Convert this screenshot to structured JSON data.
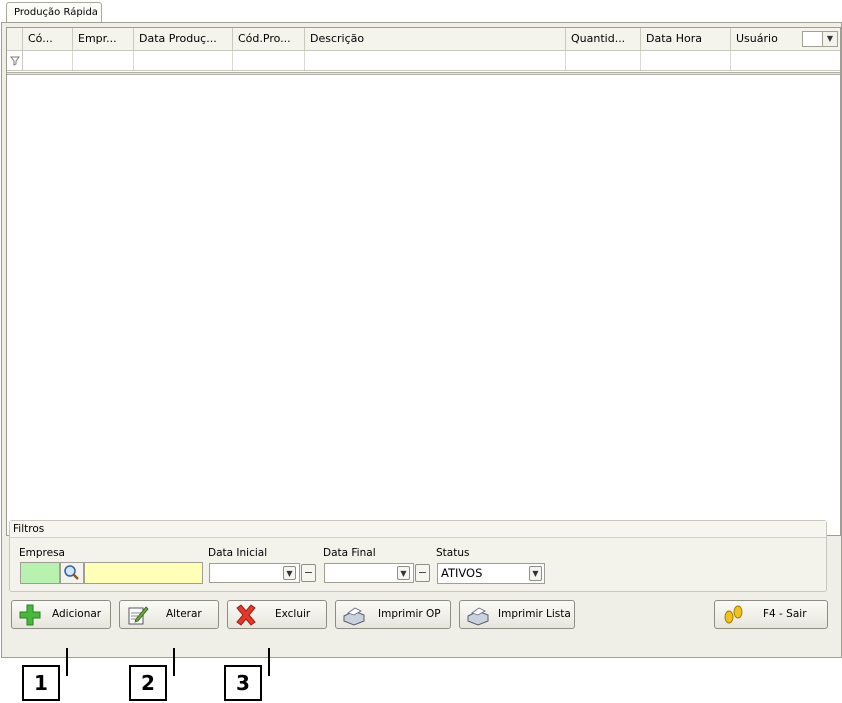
{
  "tab": {
    "label": "Produção Rápida"
  },
  "grid": {
    "columns": [
      "Có...",
      "Empr...",
      "Data Produç...",
      "Cód.Pro...",
      "Descrição",
      "Quantid...",
      "Data Hora",
      "Usuário"
    ],
    "rows": []
  },
  "filters": {
    "title": "Filtros",
    "empresa_label": "Empresa",
    "data_inicial_label": "Data Inicial",
    "data_final_label": "Data Final",
    "status_label": "Status",
    "status_value": "ATIVOS"
  },
  "buttons": {
    "adicionar": "Adicionar",
    "alterar": "Alterar",
    "excluir": "Excluir",
    "imprimir_op": "Imprimir OP",
    "imprimir_lista": "Imprimir Lista",
    "sair": "F4 - Sair"
  },
  "callouts": [
    "1",
    "2",
    "3"
  ]
}
